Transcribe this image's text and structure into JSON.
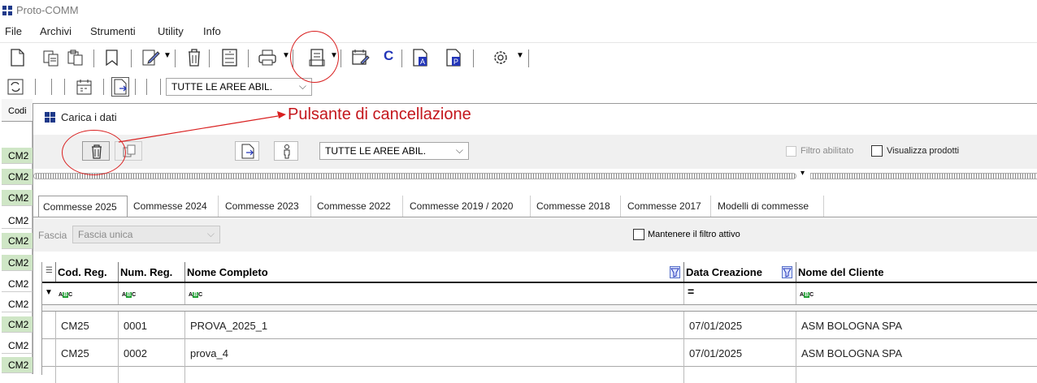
{
  "app": {
    "title": "Proto-COMM"
  },
  "menu": [
    "File",
    "Archivi",
    "Strumenti",
    "Utility",
    "Info"
  ],
  "toolbar2": {
    "area_select": "TUTTE LE AREE ABIL."
  },
  "left_grid": {
    "header": "Codi",
    "rows": [
      "CM2",
      "CM2",
      "CM2",
      "CM2",
      "CM2",
      "CM2",
      "CM2",
      "CM2",
      "CM2",
      "CM2",
      "CM2"
    ]
  },
  "dialog": {
    "title": "Carica i dati",
    "area_select": "TUTTE LE AREE ABIL.",
    "filter_enabled_label": "Filtro abilitato",
    "show_products_label": "Visualizza prodotti",
    "tabs": [
      "Commesse 2025",
      "Commesse 2024",
      "Commesse 2023",
      "Commesse 2022",
      "Commesse 2019 / 2020",
      "Commesse 2018",
      "Commesse 2017",
      "Modelli di commesse"
    ],
    "fascia_label": "Fascia",
    "fascia_value": "Fascia unica",
    "keep_filter_label": "Mantenere il filtro attivo",
    "columns": [
      "Cod. Reg.",
      "Num. Reg.",
      "Nome Completo",
      "Data Creazione",
      "Nome del Cliente"
    ],
    "date_filter_symbol": "=",
    "rows": [
      [
        "CM25",
        "0001",
        "PROVA_2025_1",
        "07/01/2025",
        "ASM BOLOGNA SPA"
      ],
      [
        "CM25",
        "0002",
        "prova_4",
        "07/01/2025",
        "ASM BOLOGNA SPA"
      ]
    ]
  },
  "annotation": {
    "label": "Pulsante di cancellazione",
    "color": "#c4161c"
  }
}
